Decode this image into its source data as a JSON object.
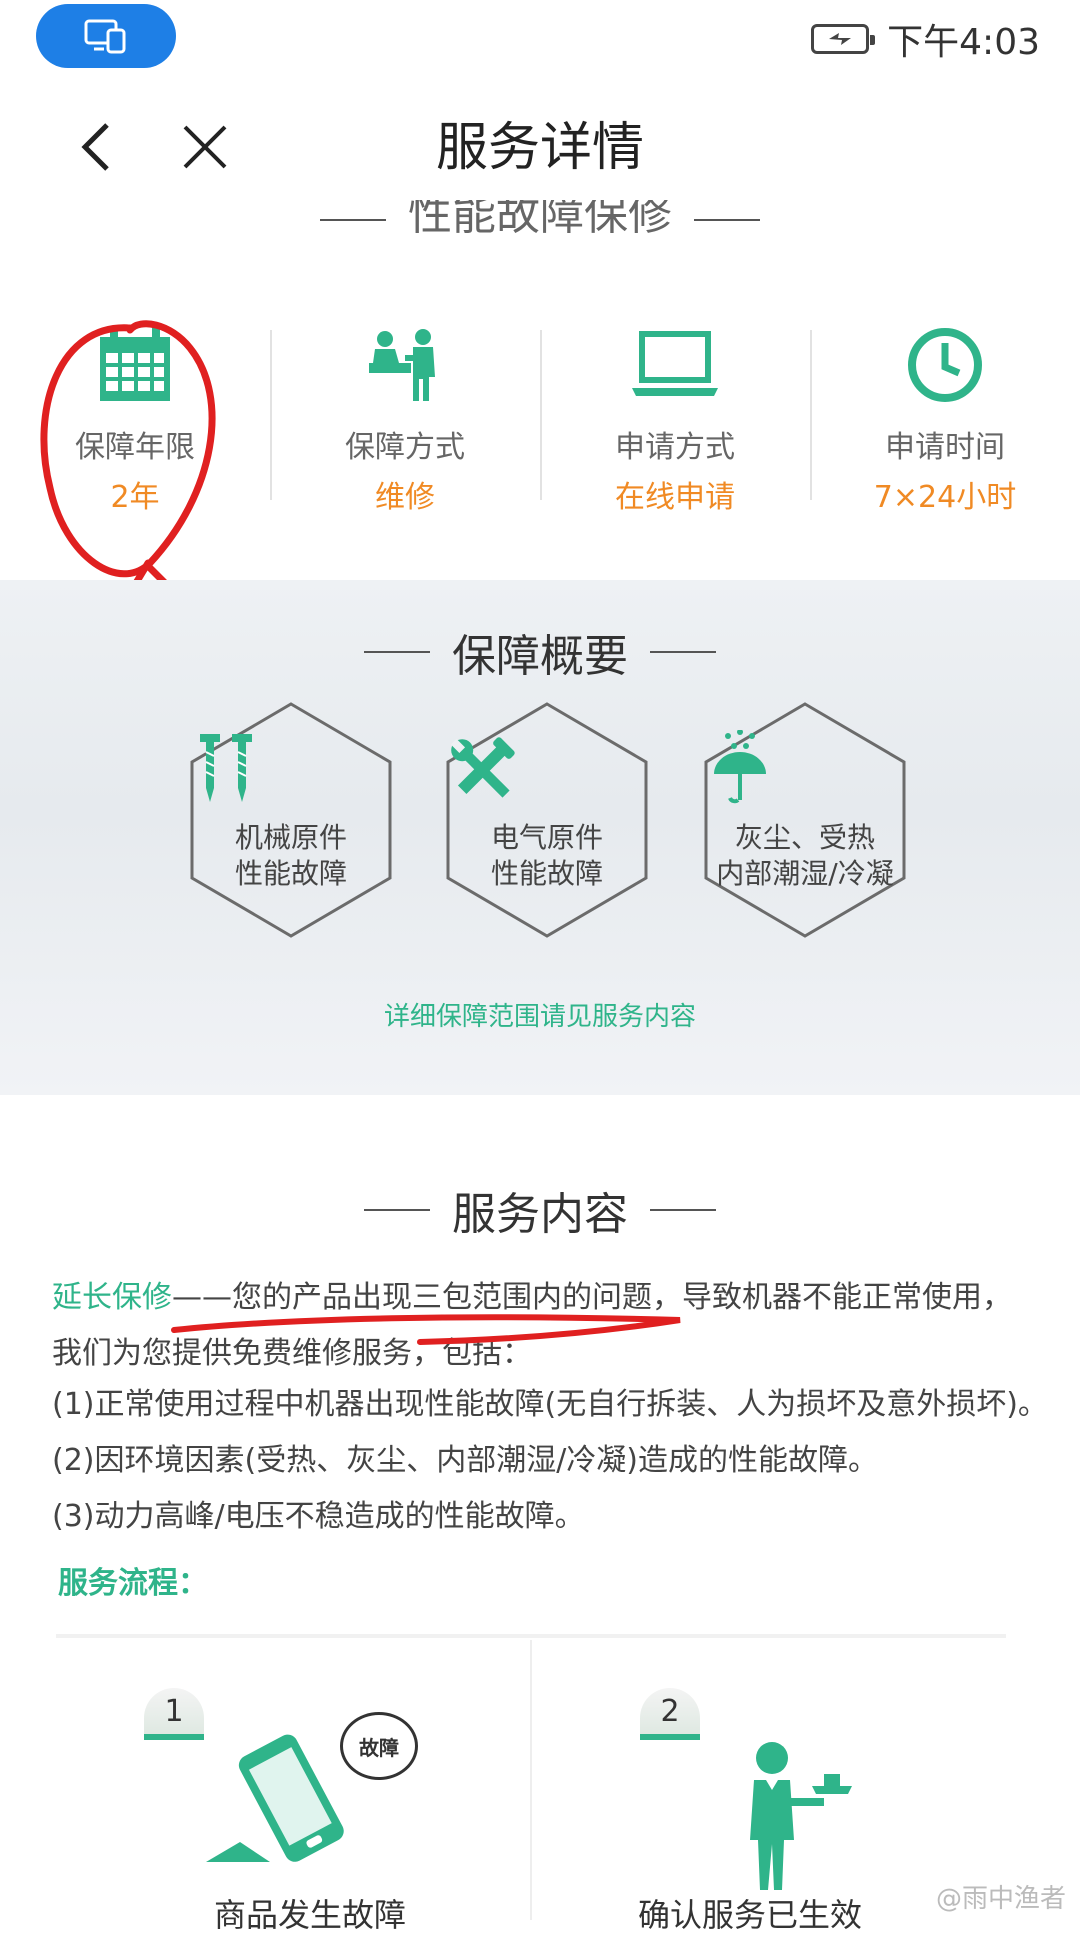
{
  "status_bar": {
    "time": "下午4:03",
    "battery_icon": "battery-charging-icon",
    "screen_icon": "screen-cast-icon"
  },
  "title_bar": {
    "title": "服务详情",
    "back_icon": "back-arrow-icon",
    "close_icon": "close-icon"
  },
  "section_partial": {
    "title": "性能故障保修"
  },
  "info": [
    {
      "icon": "calendar-icon",
      "label": "保障年限",
      "value": "2年"
    },
    {
      "icon": "service-people-icon",
      "label": "保障方式",
      "value": "维修"
    },
    {
      "icon": "laptop-icon",
      "label": "申请方式",
      "value": "在线申请"
    },
    {
      "icon": "clock-icon",
      "label": "申请时间",
      "value": "7×24小时"
    }
  ],
  "overview": {
    "title": "保障概要",
    "items": [
      {
        "icon": "screws-icon",
        "line1": "机械原件",
        "line2": "性能故障"
      },
      {
        "icon": "tools-icon",
        "line1": "电气原件",
        "line2": "性能故障"
      },
      {
        "icon": "umbrella-rain-icon",
        "line1": "灰尘、受热",
        "line2": "内部潮湿/冷凝"
      }
    ],
    "link": "详细保障范围请见服务内容"
  },
  "service": {
    "title": "服务内容",
    "lead": "延长保修",
    "text1": "——您的产品出现三包范围内的问题，导致机器不能正常使用，",
    "text2": "我们为您提供免费维修服务，包括：",
    "item1": "(1)正常使用过程中机器出现性能故障(无自行拆装、人为损坏及意外损坏)。",
    "item2": "(2)因环境因素(受热、灰尘、内部潮湿/冷凝)造成的性能故障。",
    "item3": "(3)动力高峰/电压不稳造成的性能故障。",
    "flow_title": "服务流程："
  },
  "flow": [
    {
      "num": "1",
      "icon": "broken-phone-icon",
      "badge": "故障",
      "label": "商品发生故障"
    },
    {
      "num": "2",
      "icon": "waiter-icon",
      "label": "确认服务已生效"
    }
  ],
  "watermark": "@雨中渔者",
  "colors": {
    "green": "#2fb48a",
    "orange": "#f08a24",
    "blue": "#1e7fe6",
    "annotation_red": "#e02020"
  }
}
